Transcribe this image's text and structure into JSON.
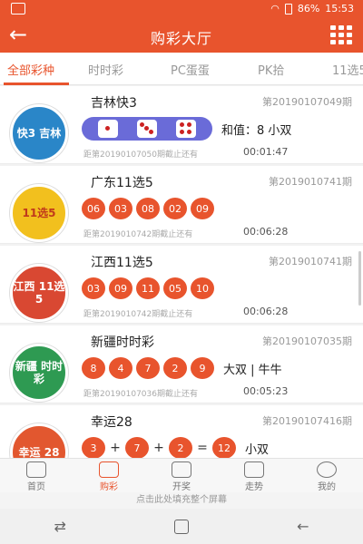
{
  "status": {
    "battery": "86%",
    "time": "15:53"
  },
  "topbar": {
    "title": "购彩大厅"
  },
  "tabs": [
    {
      "label": "全部彩种",
      "active": true
    },
    {
      "label": "时时彩"
    },
    {
      "label": "PC蛋蛋"
    },
    {
      "label": "PK拾"
    },
    {
      "label": "11选5"
    }
  ],
  "lotteries": [
    {
      "name": "吉林快3",
      "logo_text": "快3 吉林",
      "logo_color": "#2a86c8",
      "issue": "第20190107049期",
      "extra": "和值：8    小双",
      "deadline": "距第20190107050期截止还有",
      "timer": "00:01:47"
    },
    {
      "name": "广东11选5",
      "logo_text": "11选5",
      "logo_color": "#f2c01e",
      "issue": "第2019010741期",
      "balls": [
        "06",
        "03",
        "08",
        "02",
        "09"
      ],
      "deadline": "距第2019010742期截止还有",
      "timer": "00:06:28"
    },
    {
      "name": "江西11选5",
      "logo_text": "江西 11选5",
      "logo_color": "#d94832",
      "issue": "第2019010741期",
      "balls": [
        "03",
        "09",
        "11",
        "05",
        "10"
      ],
      "deadline": "距第2019010742期截止还有",
      "timer": "00:06:28"
    },
    {
      "name": "新疆时时彩",
      "logo_text": "新疆 时时彩",
      "logo_color": "#2e9a52",
      "issue": "第20190107035期",
      "balls": [
        "8",
        "4",
        "7",
        "2",
        "9"
      ],
      "extra": "大双 | 牛牛",
      "deadline": "距第20190107036期截止还有",
      "timer": "00:05:23"
    },
    {
      "name": "幸运28",
      "logo_text": "幸运 28",
      "logo_color": "#e2572f",
      "issue": "第20190107416期",
      "sum": [
        "3",
        "7",
        "2",
        "12"
      ],
      "extra": "小双"
    }
  ],
  "bottomnav": [
    {
      "label": "首页"
    },
    {
      "label": "购彩",
      "active": true
    },
    {
      "label": "开奖"
    },
    {
      "label": "走势"
    },
    {
      "label": "我的"
    }
  ],
  "hint": "点击此处填充整个屏幕",
  "sysnav": {
    "left": "⇄",
    "right": "←"
  },
  "colors": {
    "brand": "#e8542d",
    "dice_bar": "#6a6bd8"
  },
  "icons": [
    "back-arrow-icon",
    "grid-menu-icon",
    "home-icon",
    "cart-icon",
    "gift-icon",
    "chart-icon",
    "user-icon"
  ]
}
